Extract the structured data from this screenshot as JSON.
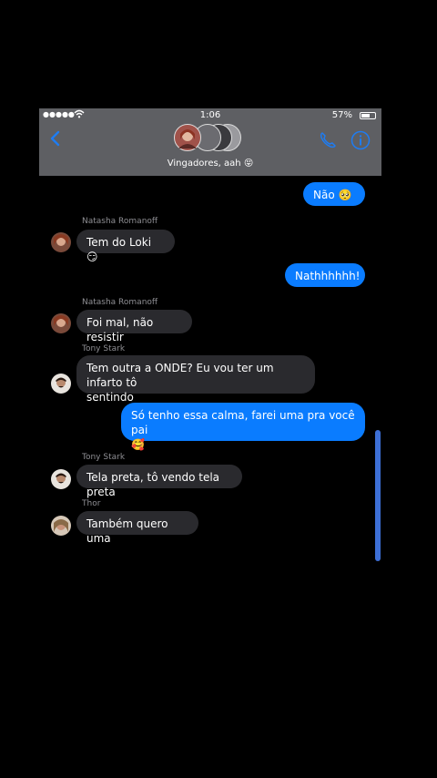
{
  "status_bar": {
    "signal": "●●●●●",
    "time": "1:06",
    "battery": "57%",
    "battery_level": 0.57
  },
  "header": {
    "group_name": "Vingadores, aah 😝"
  },
  "messages": [
    {
      "dir": "out",
      "text": "Não 🥺"
    },
    {
      "dir": "in",
      "sender": "Natasha Romanoff",
      "text": "Tem do Loki 😏"
    },
    {
      "dir": "out",
      "text": "Nathhhhhh!"
    },
    {
      "dir": "in",
      "sender": "Natasha Romanoff",
      "text": "Foi mal, não resistir"
    },
    {
      "dir": "in",
      "sender": "Tony Stark",
      "text_l1": "Tem outra a ONDE? Eu vou ter um infarto tô",
      "text_l2": "sentindo"
    },
    {
      "dir": "out",
      "text_l1": "Só tenho essa calma, farei uma pra você pai",
      "text_l2": "🥰"
    },
    {
      "dir": "in",
      "sender": "Tony Stark",
      "text": "Tela preta, tô vendo tela preta"
    },
    {
      "dir": "in",
      "sender": "Thor",
      "text": "Também quero uma"
    }
  ],
  "colors": {
    "outgoing": "#0a7cff",
    "incoming": "#2a2a2e",
    "header": "#5e5f63",
    "accent": "#1e7cf2"
  }
}
